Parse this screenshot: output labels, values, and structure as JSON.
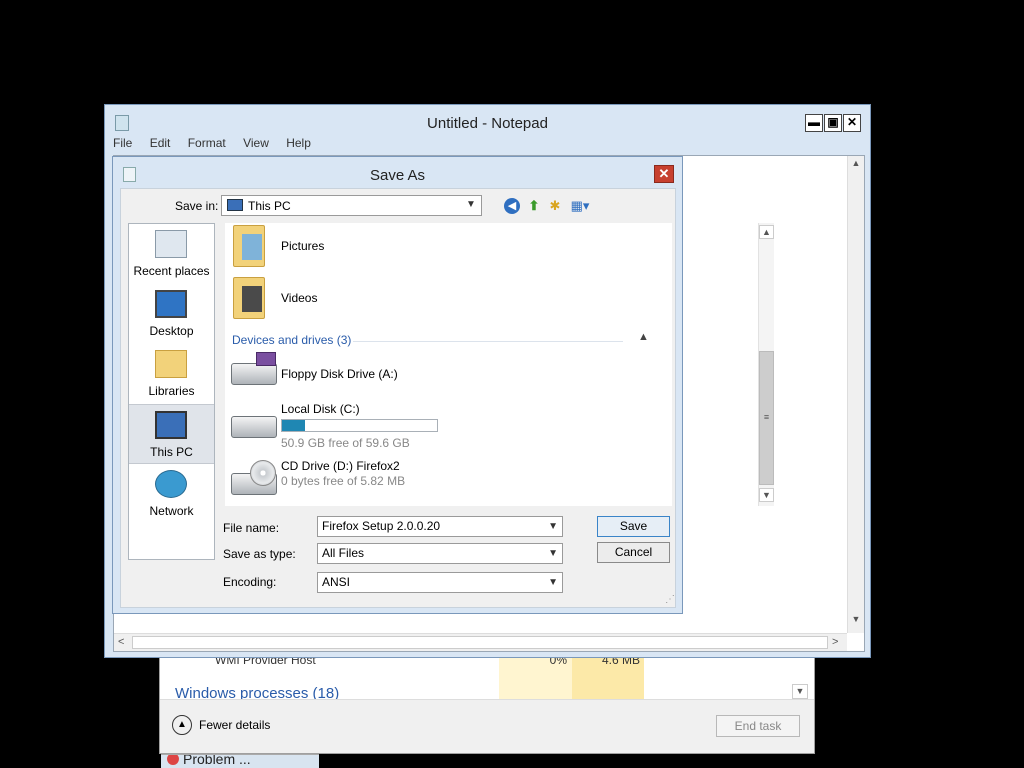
{
  "task_manager": {
    "row_text": "WMI Provider Host",
    "cpu": "0%",
    "memory": "4.6 MB",
    "group_label": "Windows processes (18)",
    "fewer_details": "Fewer details",
    "end_task": "End task",
    "taskbar_label": "Problem ..."
  },
  "notepad": {
    "title": "Untitled - Notepad",
    "menu": [
      "File",
      "Edit",
      "Format",
      "View",
      "Help"
    ],
    "min_glyph": "▬",
    "max_glyph": "▣",
    "close_glyph": "✕"
  },
  "dialog": {
    "title": "Save As",
    "close_glyph": "✕",
    "save_in_label": "Save in:",
    "save_in_value": "This PC",
    "places": [
      {
        "label": "Recent places",
        "icon": "recent-places-icon"
      },
      {
        "label": "Desktop",
        "icon": "desktop-icon"
      },
      {
        "label": "Libraries",
        "icon": "libraries-icon"
      },
      {
        "label": "This PC",
        "icon": "this-pc-icon"
      },
      {
        "label": "Network",
        "icon": "network-icon"
      }
    ],
    "folders": [
      {
        "label": "Pictures",
        "icon": "pictures-folder-icon"
      },
      {
        "label": "Videos",
        "icon": "videos-folder-icon"
      }
    ],
    "group_header": "Devices and drives (3)",
    "drives": [
      {
        "label": "Floppy Disk Drive (A:)",
        "sub": "",
        "icon": "floppy-drive-icon"
      },
      {
        "label": "Local Disk (C:)",
        "sub": "50.9 GB free of 59.6 GB",
        "icon": "hard-disk-icon",
        "used_fraction": 0.146
      },
      {
        "label": "CD Drive (D:) Firefox2",
        "sub": "0 bytes free of 5.82 MB",
        "icon": "cd-drive-icon"
      }
    ],
    "file_name_label": "File name:",
    "file_name_value": "Firefox Setup 2.0.0.20",
    "save_as_type_label": "Save as type:",
    "save_as_type_value": "All Files",
    "encoding_label": "Encoding:",
    "encoding_value": "ANSI",
    "save_button": "Save",
    "cancel_button": "Cancel"
  },
  "colors": {
    "accent": "#2a5caa",
    "disk_bar": "#1f87b3",
    "close_red": "#c7402f",
    "window_frame": "#d9e6f4"
  }
}
